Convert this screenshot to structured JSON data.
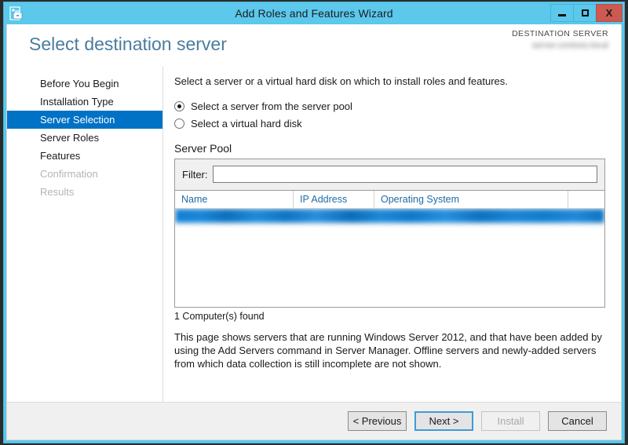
{
  "window": {
    "title": "Add Roles and Features Wizard",
    "icon": "server-wizard-icon",
    "minimize_label": "minimize",
    "maximize_label": "maximize",
    "close_label": "X",
    "titlebar_color": "#5BC8EC",
    "close_color": "#CC5A52"
  },
  "header": {
    "page_title": "Select destination server",
    "destination_label": "DESTINATION SERVER",
    "destination_value": "",
    "title_color": "#4A7C9E"
  },
  "sidebar": {
    "items": [
      {
        "label": "Before You Begin",
        "state": "normal"
      },
      {
        "label": "Installation Type",
        "state": "normal"
      },
      {
        "label": "Server Selection",
        "state": "selected"
      },
      {
        "label": "Server Roles",
        "state": "normal"
      },
      {
        "label": "Features",
        "state": "normal"
      },
      {
        "label": "Confirmation",
        "state": "disabled"
      },
      {
        "label": "Results",
        "state": "disabled"
      }
    ],
    "selected_color": "#0072C6"
  },
  "main": {
    "intro": "Select a server or a virtual hard disk on which to install roles and features.",
    "radios": [
      {
        "label": "Select a server from the server pool",
        "checked": true
      },
      {
        "label": "Select a virtual hard disk",
        "checked": false
      }
    ],
    "section_title": "Server Pool",
    "filter": {
      "label": "Filter:",
      "value": "",
      "placeholder": ""
    },
    "grid": {
      "columns": [
        "Name",
        "IP Address",
        "Operating System",
        ""
      ],
      "rows": [
        {
          "name": "",
          "ip_address": "",
          "operating_system": "",
          "selected": true,
          "redacted": true
        }
      ],
      "header_color": "#1F6BA8",
      "selection_color": "#0072C6"
    },
    "found_text": "1 Computer(s) found",
    "description": "This page shows servers that are running Windows Server 2012, and that have been added by using the Add Servers command in Server Manager. Offline servers and newly-added servers from which data collection is still incomplete are not shown."
  },
  "footer": {
    "buttons": [
      {
        "label": "< Previous",
        "state": "normal"
      },
      {
        "label": "Next >",
        "state": "focused"
      },
      {
        "label": "Install",
        "state": "disabled"
      },
      {
        "label": "Cancel",
        "state": "normal"
      }
    ]
  }
}
